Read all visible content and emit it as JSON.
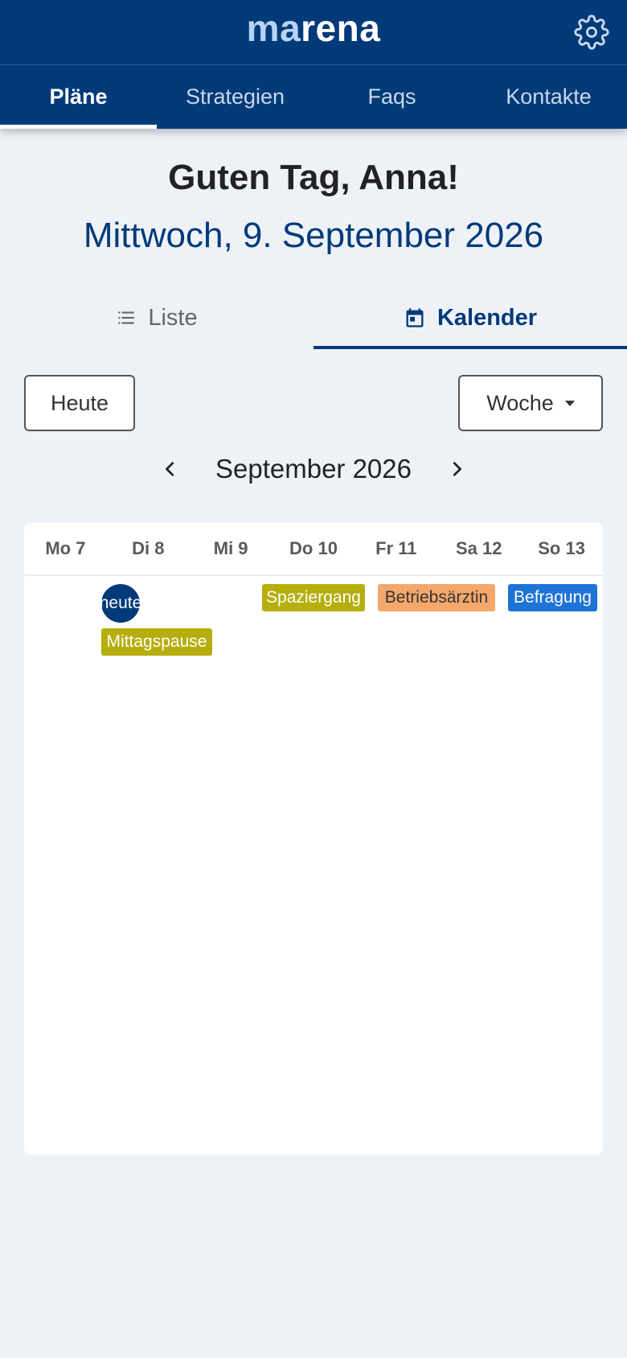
{
  "header": {
    "brand_prefix": "ma",
    "brand_suffix": "rena",
    "settings_icon": "gear-icon"
  },
  "nav": {
    "tabs": [
      {
        "label": "Pläne",
        "active": true
      },
      {
        "label": "Strategien",
        "active": false
      },
      {
        "label": "Faqs",
        "active": false
      },
      {
        "label": "Kontakte",
        "active": false
      }
    ]
  },
  "greeting": {
    "title": "Guten Tag, Anna!",
    "date": "Mittwoch, 9. September 2026"
  },
  "view_switch": {
    "list": {
      "label": "Liste",
      "icon": "list-icon",
      "active": false
    },
    "calendar": {
      "label": "Kalender",
      "icon": "calendar-icon",
      "active": true
    }
  },
  "controls": {
    "today_label": "Heute",
    "view_select_label": "Woche"
  },
  "month_nav": {
    "title": "September 2026",
    "prev_icon": "chevron-left-icon",
    "next_icon": "chevron-right-icon"
  },
  "calendar": {
    "days": [
      "Mo 7",
      "Di 8",
      "Mi 9",
      "Do 10",
      "Fr 11",
      "Sa 12",
      "So 13"
    ],
    "today_marker": "heute",
    "events": [
      {
        "label": "Mittagspause",
        "day": "Di 8",
        "color": "#b5ae0c",
        "text_color": "#ffffff"
      },
      {
        "label": "Spaziergang",
        "day": "Do 10",
        "color": "#b5ae0c",
        "text_color": "#ffffff"
      },
      {
        "label": "Betriebsärztin",
        "day": "Fr 11",
        "color": "#f5a86b",
        "text_color": "#333333"
      },
      {
        "label": "Befragung",
        "day": "So 13",
        "color": "#1e73d6",
        "text_color": "#ffffff"
      }
    ]
  },
  "colors": {
    "primary": "#003a79",
    "background": "#eef2f7",
    "brand_accent": "#b7d2f3"
  }
}
